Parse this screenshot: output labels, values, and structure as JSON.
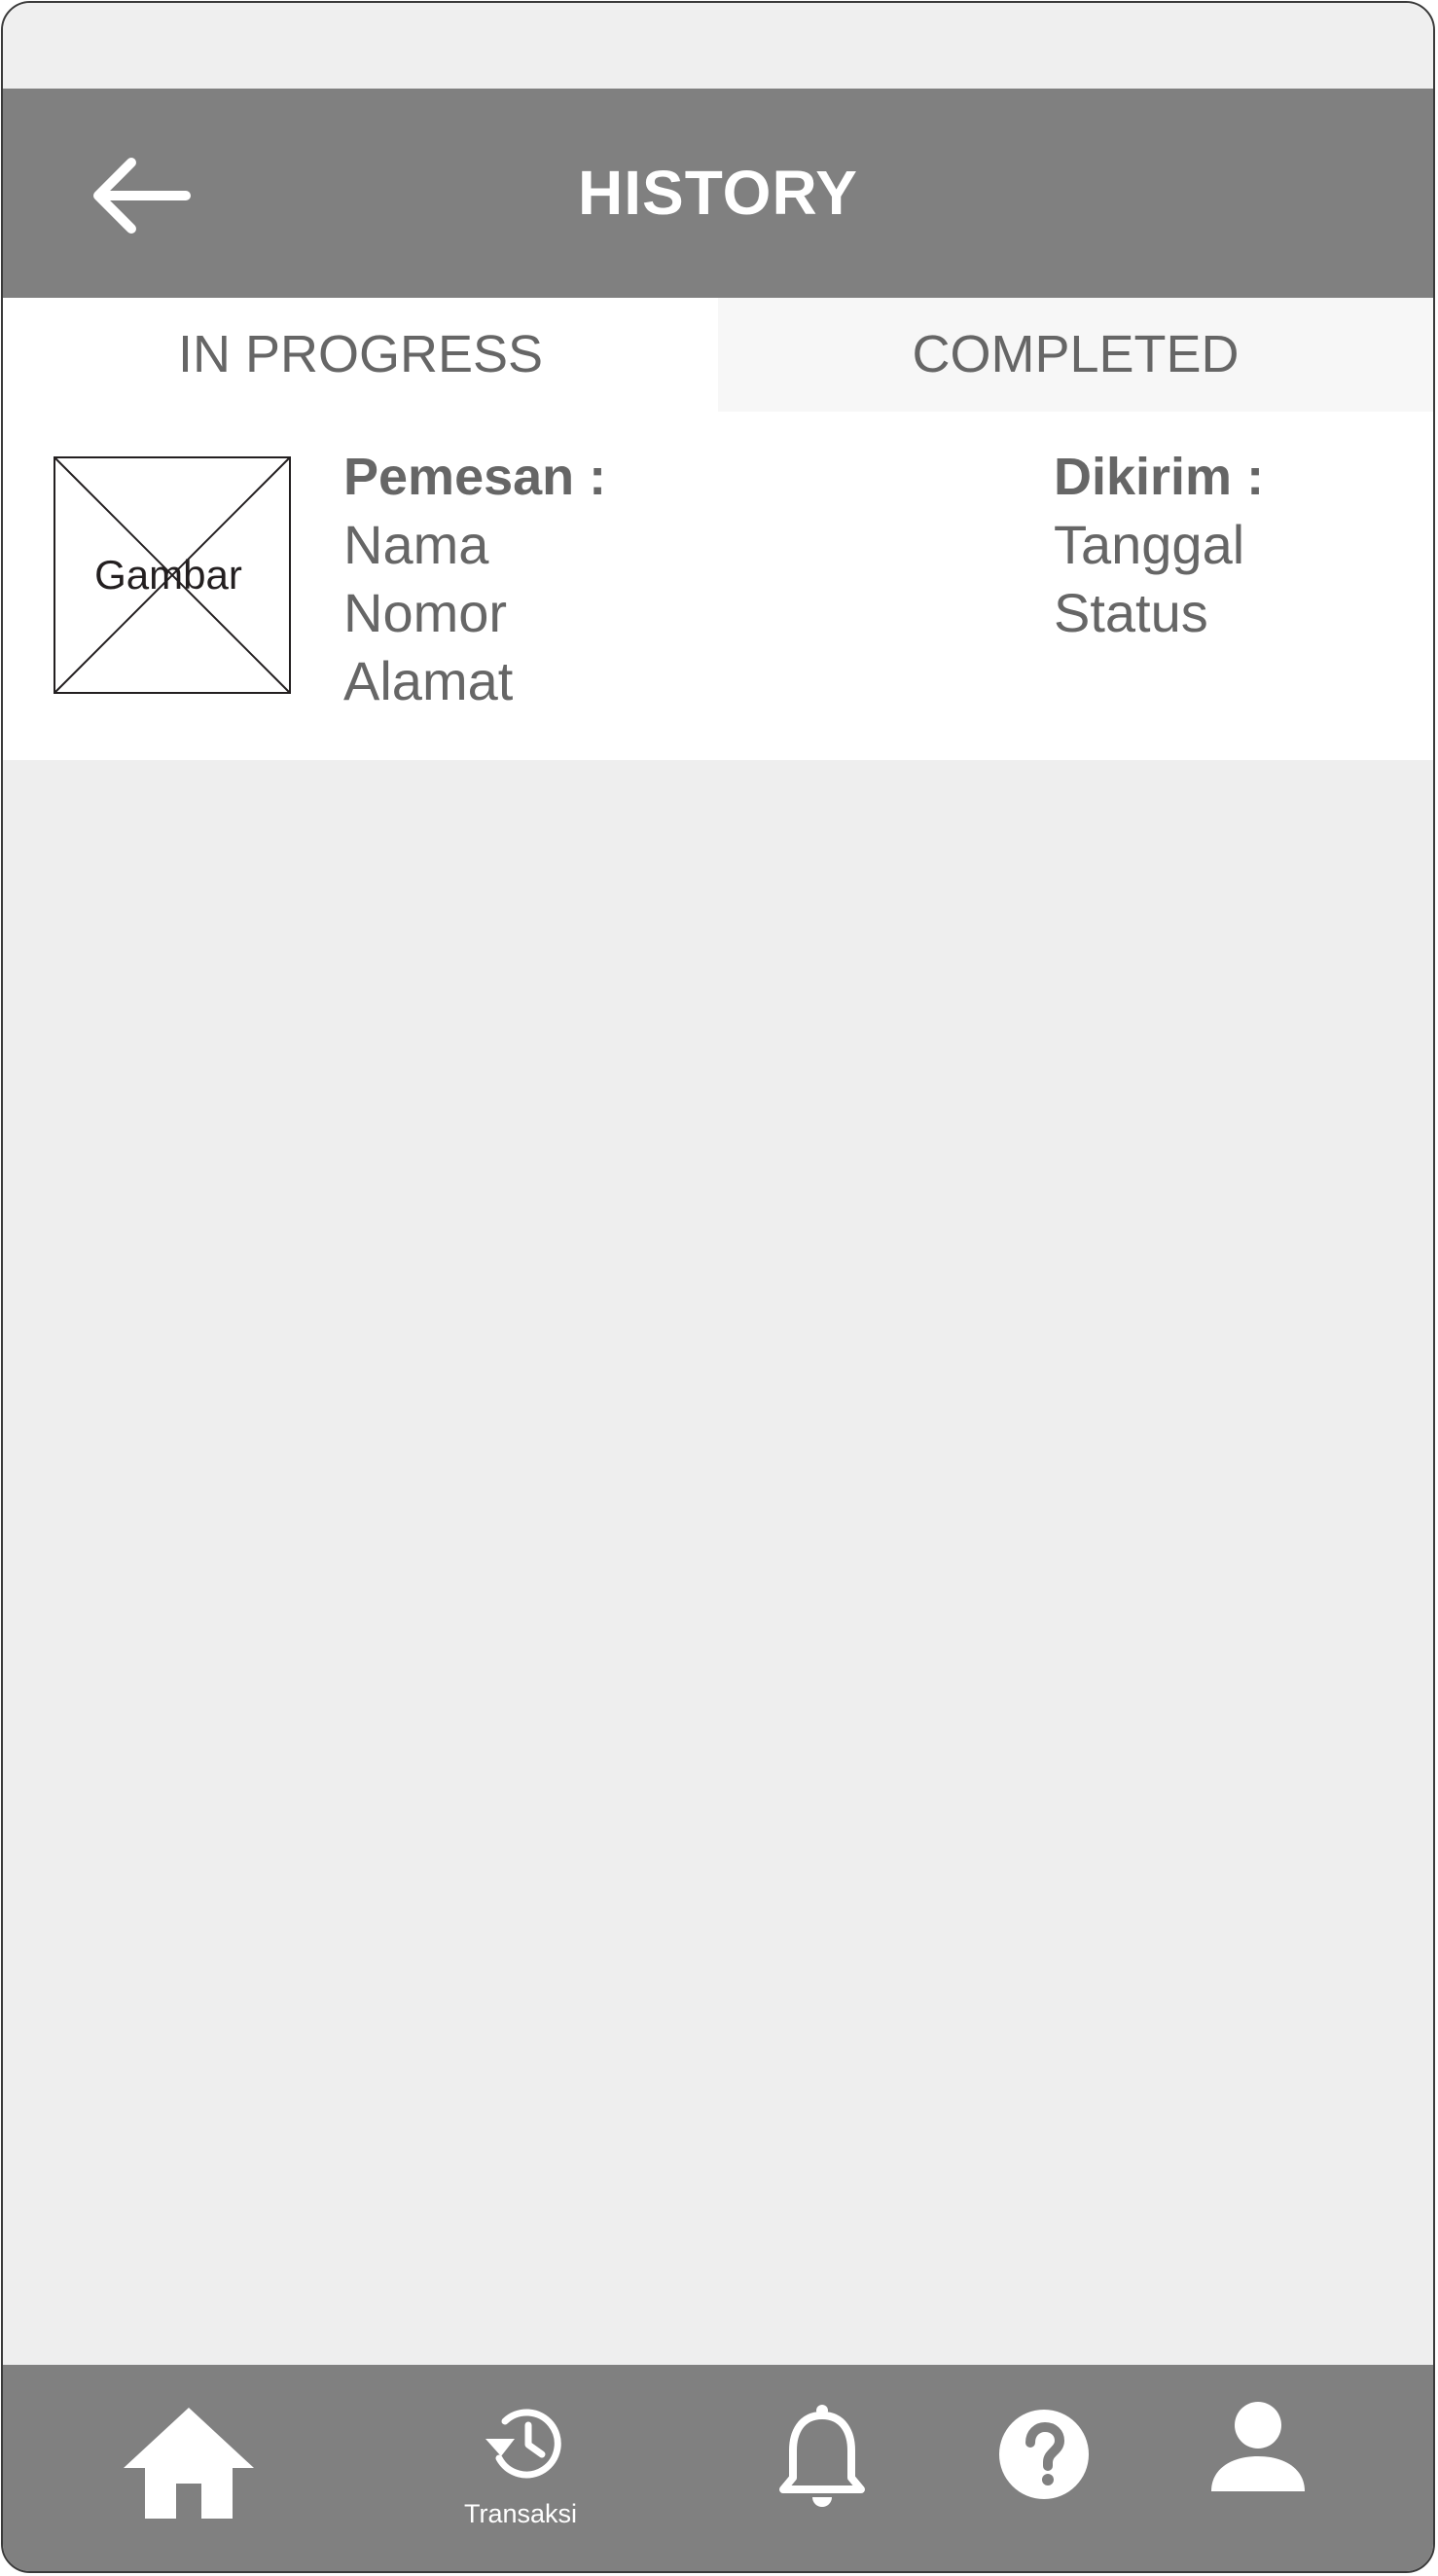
{
  "header": {
    "title": "HISTORY"
  },
  "tabs": [
    {
      "label": "IN PROGRESS",
      "active": true
    },
    {
      "label": "COMPLETED",
      "active": false
    }
  ],
  "order": {
    "image_placeholder": "Gambar",
    "left": {
      "heading": "Pemesan :",
      "lines": [
        "Nama",
        "Nomor",
        "Alamat"
      ]
    },
    "right": {
      "heading": "Dikirim :",
      "lines": [
        "Tanggal",
        "Status"
      ]
    }
  },
  "bottom_nav": [
    {
      "id": "home",
      "icon": "home-icon",
      "label": ""
    },
    {
      "id": "transaksi",
      "icon": "history-icon",
      "label": "Transaksi"
    },
    {
      "id": "notifications",
      "icon": "bell-icon",
      "label": ""
    },
    {
      "id": "help",
      "icon": "help-icon",
      "label": ""
    },
    {
      "id": "profile",
      "icon": "user-icon",
      "label": ""
    }
  ],
  "colors": {
    "bar": "#808080",
    "text": "#666666",
    "background": "#eeeeee"
  }
}
